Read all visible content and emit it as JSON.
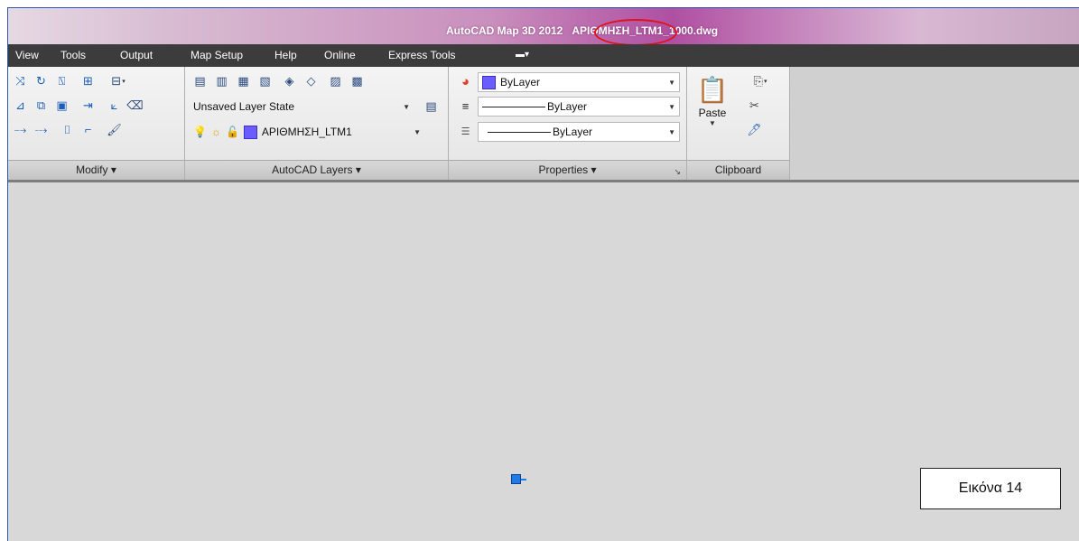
{
  "window": {
    "title_prefix": "AutoCAD Map 3D 2012",
    "title_highlight": "ΑΡΙΘΜΗΣΗ_LTM1_1000.dwg"
  },
  "menubar": {
    "items": [
      "View",
      "Tools",
      "Output",
      "Map Setup",
      "Help",
      "Online",
      "Express Tools"
    ]
  },
  "ribbon": {
    "panels": {
      "modify": {
        "label": "Modify ▾"
      },
      "layers": {
        "label": "AutoCAD Layers ▾",
        "layer_state": "Unsaved Layer State",
        "current_layer": "ΑΡΙΘΜΗΣΗ_LTM1"
      },
      "properties": {
        "label": "Properties ▾",
        "color": "ByLayer",
        "lineweight": "ByLayer",
        "linetype": "ByLayer"
      },
      "clipboard": {
        "label": "Clipboard",
        "paste": "Paste"
      }
    }
  },
  "canvas": {
    "caption": "Εικόνα 14"
  },
  "colors": {
    "menubar": "#3c3c3c",
    "annotation_circle": "#e0121b",
    "layer_color": "#6a5cff",
    "grip": "#1e7be8"
  }
}
